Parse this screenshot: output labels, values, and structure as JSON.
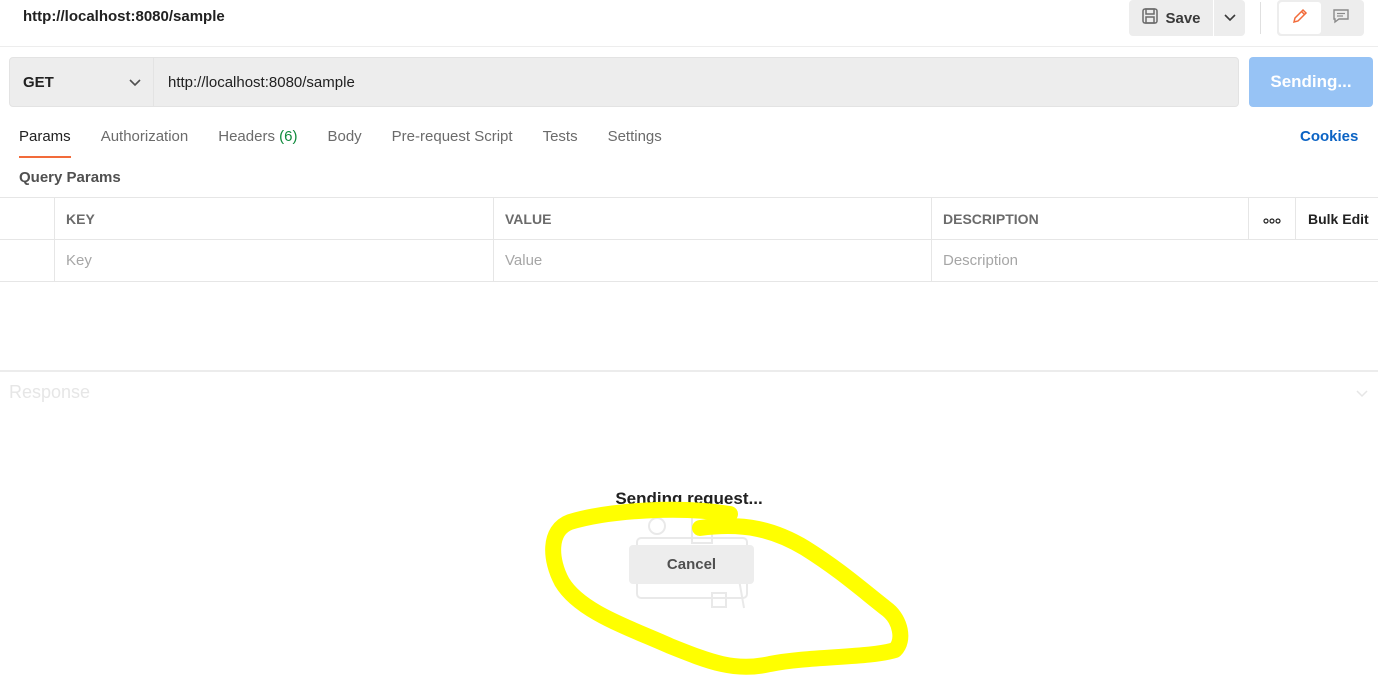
{
  "header": {
    "title": "http://localhost:8080/sample",
    "save_label": "Save"
  },
  "request": {
    "method": "GET",
    "url": "http://localhost:8080/sample",
    "send_label": "Sending..."
  },
  "tabs": [
    {
      "label": "Params",
      "active": true
    },
    {
      "label": "Authorization"
    },
    {
      "label": "Headers",
      "count": "(6)"
    },
    {
      "label": "Body"
    },
    {
      "label": "Pre-request Script"
    },
    {
      "label": "Tests"
    },
    {
      "label": "Settings"
    }
  ],
  "cookies_label": "Cookies",
  "query_params": {
    "title": "Query Params",
    "columns": {
      "key": "KEY",
      "value": "VALUE",
      "description": "DESCRIPTION"
    },
    "bulk_edit_label": "Bulk Edit",
    "placeholders": {
      "key": "Key",
      "value": "Value",
      "description": "Description"
    }
  },
  "response": {
    "title": "Response",
    "status_text": "Sending request...",
    "cancel_label": "Cancel"
  },
  "colors": {
    "accent_tab": "#f26b3a",
    "send_button": "#97c3f5",
    "link": "#0b63c4",
    "count": "#0f8a3c",
    "annotation": "#ffff00"
  },
  "icons": [
    "save-icon",
    "chevron-down-icon",
    "edit-pencil-icon",
    "comment-icon",
    "more-options-icon",
    "collapse-chevron-icon"
  ]
}
